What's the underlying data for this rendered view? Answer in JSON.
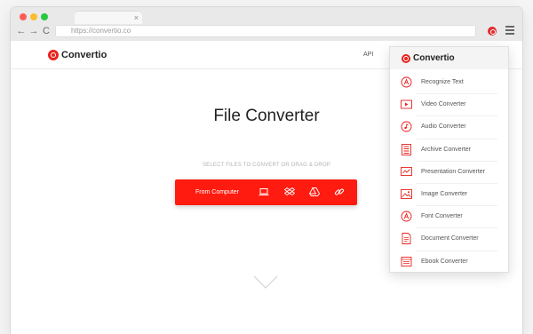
{
  "browser": {
    "url": "https://convertio.co",
    "tab_close": "×",
    "back_glyph": "←",
    "forward_glyph": "→",
    "reload_glyph": "C"
  },
  "site": {
    "logo": "Convertio",
    "nav_api": "API",
    "title": "File Converter",
    "select_hint": "SELECT FILES TO CONVERT OR DRAG & DROP",
    "from_computer": "From Computer",
    "upload_icons": [
      "laptop-icon",
      "dropbox-icon",
      "google-drive-icon",
      "link-icon"
    ]
  },
  "dropdown": {
    "logo": "Convertio",
    "items": [
      {
        "label": "Recognize Text",
        "icon": "ocr-icon"
      },
      {
        "label": "Video Converter",
        "icon": "video-icon"
      },
      {
        "label": "Audio Converter",
        "icon": "audio-icon"
      },
      {
        "label": "Archive Converter",
        "icon": "archive-icon"
      },
      {
        "label": "Presentation Converter",
        "icon": "presentation-icon"
      },
      {
        "label": "Image Converter",
        "icon": "image-icon"
      },
      {
        "label": "Font Converter",
        "icon": "font-icon"
      },
      {
        "label": "Document Converter",
        "icon": "document-icon"
      },
      {
        "label": "Ebook Converter",
        "icon": "ebook-icon"
      }
    ]
  },
  "colors": {
    "brand_red": "#e8231f",
    "upload_bar": "#ff1b10",
    "dropdown_icon": "#e8231f"
  }
}
